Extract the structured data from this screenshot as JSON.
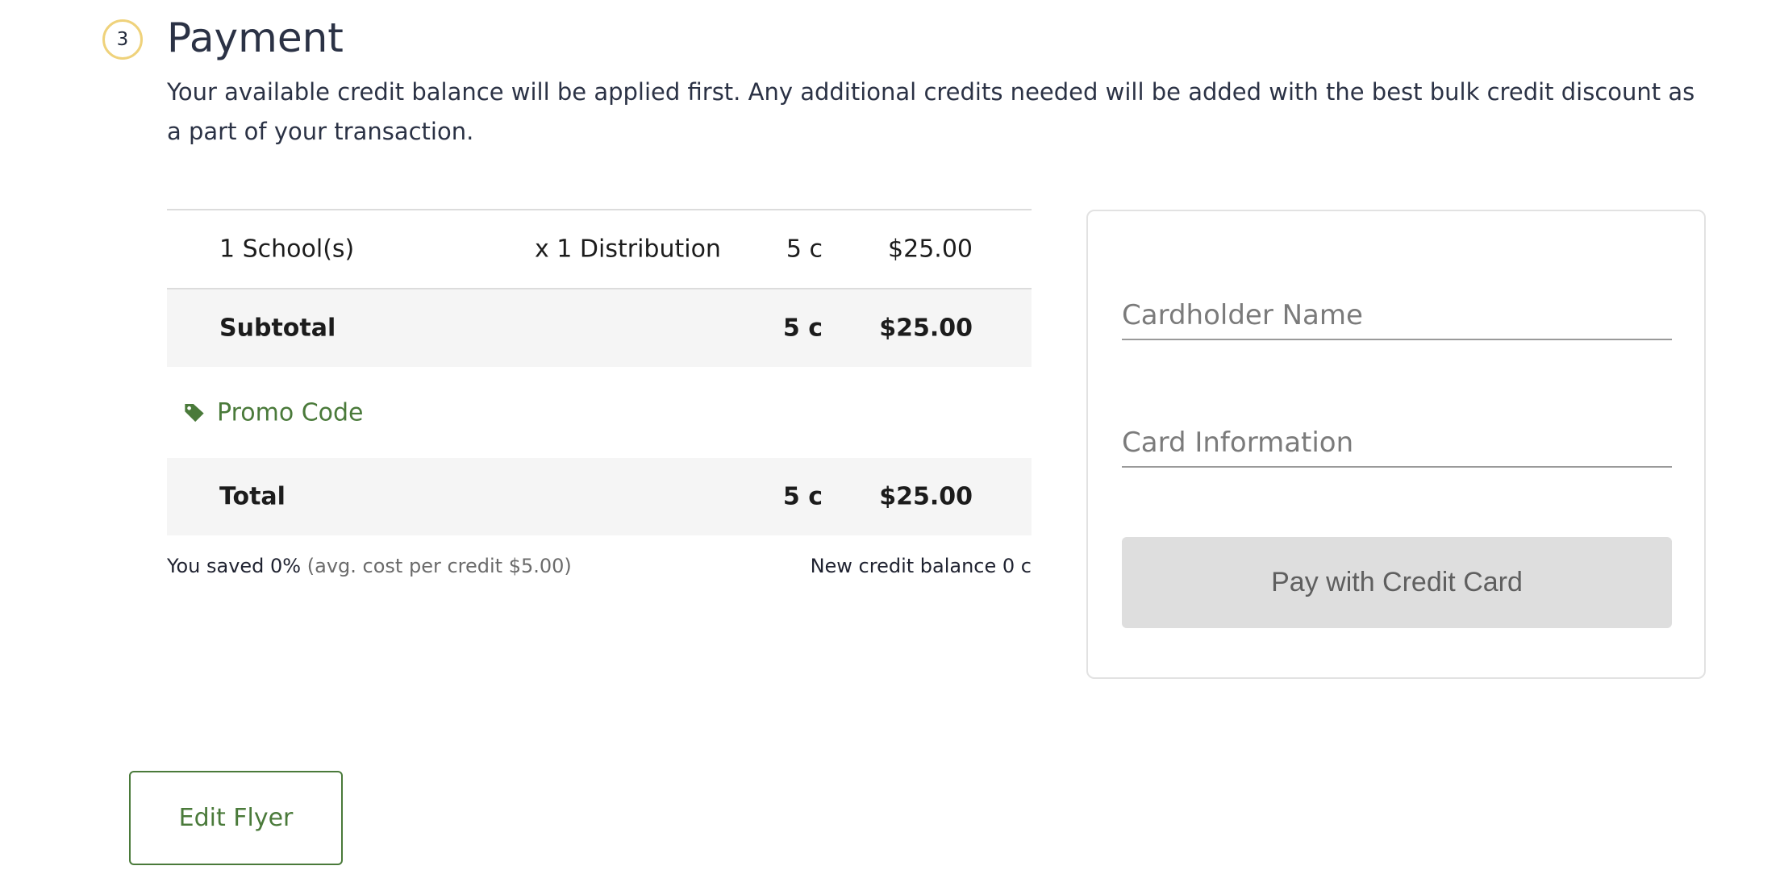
{
  "step": {
    "number": "3",
    "title": "Payment",
    "intro": "Your available credit balance will be applied first. Any additional credits needed will be added with the best bulk credit discount as a part of your transaction."
  },
  "summary": {
    "line_item": {
      "name": "1 School(s)",
      "distribution": "x 1 Distribution",
      "credits": "5 c",
      "price": "$25.00"
    },
    "subtotal": {
      "label": "Subtotal",
      "credits": "5 c",
      "price": "$25.00"
    },
    "promo": {
      "label": "Promo Code",
      "icon": "tag-icon"
    },
    "total": {
      "label": "Total",
      "credits": "5 c",
      "price": "$25.00"
    },
    "saved_text": "You saved 0%",
    "avg_text": "(avg. cost per credit $5.00)",
    "balance_text": "New credit balance 0 c"
  },
  "payment": {
    "cardholder_placeholder": "Cardholder Name",
    "card_info_placeholder": "Card Information",
    "pay_button_label": "Pay with Credit Card"
  },
  "actions": {
    "edit_flyer_label": "Edit Flyer"
  },
  "colors": {
    "accent_green": "#4a7a3a",
    "badge_ring": "#efd27b",
    "shaded_row": "#f5f5f5"
  }
}
